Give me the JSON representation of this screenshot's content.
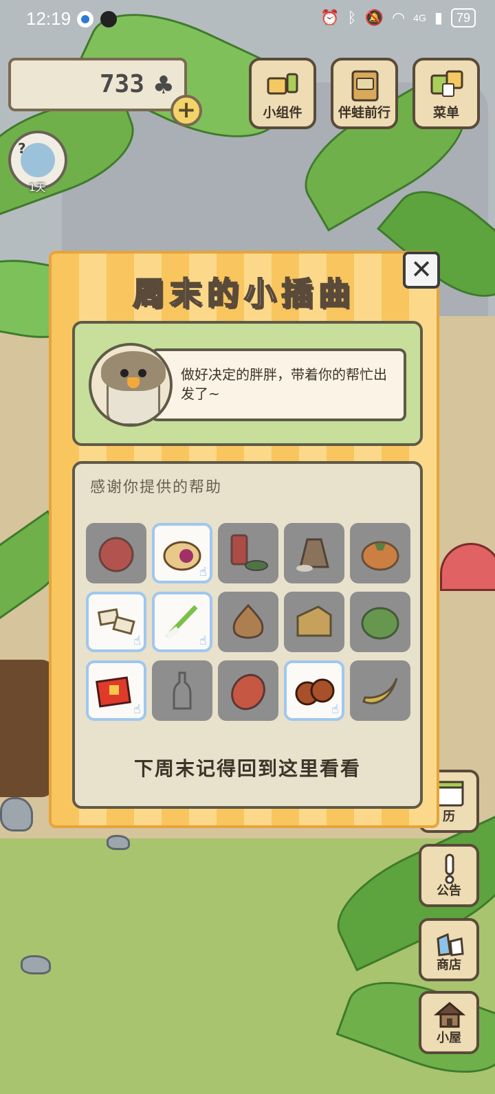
{
  "status_bar": {
    "time": "12:19",
    "network": "4G",
    "battery": "79"
  },
  "hud": {
    "clover_count": "733",
    "clover_icon": "♣",
    "plus_label": "+",
    "day_label": "1天",
    "top_buttons": [
      {
        "label": "小组件",
        "icon": "widget-icon"
      },
      {
        "label": "伴蛙前行",
        "icon": "journey-book-icon"
      },
      {
        "label": "菜单",
        "icon": "menu-cards-icon"
      }
    ],
    "side_buttons": [
      {
        "label": "历",
        "icon": "calendar-icon"
      },
      {
        "label": "公告",
        "icon": "exclamation-icon"
      },
      {
        "label": "商店",
        "icon": "shop-bags-icon"
      },
      {
        "label": "小屋",
        "icon": "house-icon"
      }
    ]
  },
  "dialog": {
    "title": "周末的小插曲",
    "close_label": "✕",
    "message": "做好决定的胖胖，带着你的帮忙出发了~",
    "items_heading": "感谢你提供的帮助",
    "footer": "下周末记得回到这里看看",
    "items": [
      {
        "name": "peach",
        "collected": false
      },
      {
        "name": "mooncake",
        "collected": true
      },
      {
        "name": "tea-can-and-leaves",
        "collected": false
      },
      {
        "name": "rice-sack",
        "collected": false
      },
      {
        "name": "persimmon",
        "collected": false
      },
      {
        "name": "sesame-candy",
        "collected": true
      },
      {
        "name": "green-onion",
        "collected": true
      },
      {
        "name": "onion",
        "collected": false
      },
      {
        "name": "cheese",
        "collected": false
      },
      {
        "name": "cabbage",
        "collected": false
      },
      {
        "name": "gift-box",
        "collected": true
      },
      {
        "name": "bottle",
        "collected": false
      },
      {
        "name": "mango",
        "collected": false
      },
      {
        "name": "chestnuts",
        "collected": true
      },
      {
        "name": "banana",
        "collected": false
      }
    ]
  }
}
